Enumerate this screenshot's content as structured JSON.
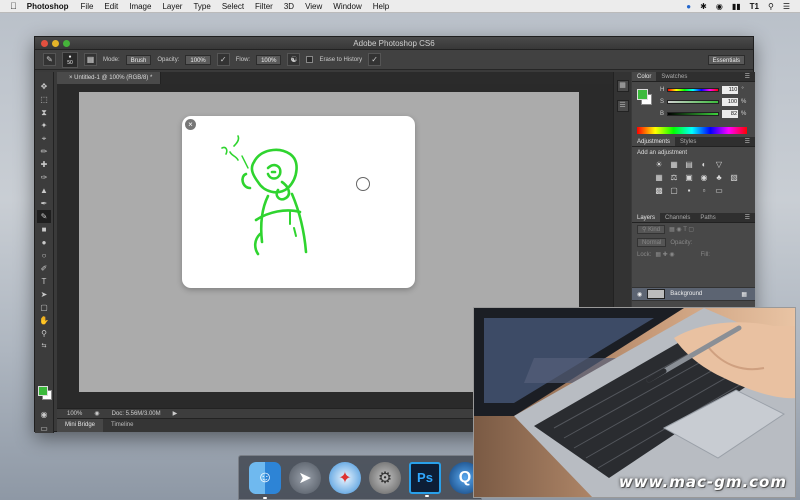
{
  "menubar": {
    "app": "Photoshop",
    "items": [
      "File",
      "Edit",
      "Image",
      "Layer",
      "Type",
      "Select",
      "Filter",
      "3D",
      "View",
      "Window",
      "Help"
    ],
    "user": "T1"
  },
  "window": {
    "title": "Adobe Photoshop CS6"
  },
  "options": {
    "brush_size": "50",
    "mode_label": "Mode:",
    "mode_value": "Brush",
    "opacity_label": "Opacity:",
    "opacity_value": "100%",
    "flow_label": "Flow:",
    "flow_value": "100%",
    "erase_history": "Erase to History",
    "workspace": "Essentials"
  },
  "document": {
    "tab": "Untitled-1 @ 100% (RGB/8) *",
    "zoom": "100%",
    "doc_info": "Doc: 5.56M/3.00M"
  },
  "bottom_tabs": [
    "Mini Bridge",
    "Timeline"
  ],
  "panels": {
    "color_tabs": [
      "Color",
      "Swatches"
    ],
    "hsb": [
      {
        "label": "H",
        "value": "110",
        "unit": "°"
      },
      {
        "label": "S",
        "value": "100",
        "unit": "%"
      },
      {
        "label": "B",
        "value": "82",
        "unit": "%"
      }
    ],
    "adj_tabs": [
      "Adjustments",
      "Styles"
    ],
    "adj_label": "Add an adjustment",
    "layer_tabs": [
      "Layers",
      "Channels",
      "Paths"
    ],
    "layer_kind": "Kind",
    "blend_mode": "Normal",
    "opacity_label": "Opacity:",
    "lock_label": "Lock:",
    "fill_label": "Fill:",
    "layer_name": "Background"
  },
  "colors": {
    "foreground": "#3cba3c",
    "stroke": "#2fd42f"
  },
  "watermark": "www.mac-gm.com"
}
